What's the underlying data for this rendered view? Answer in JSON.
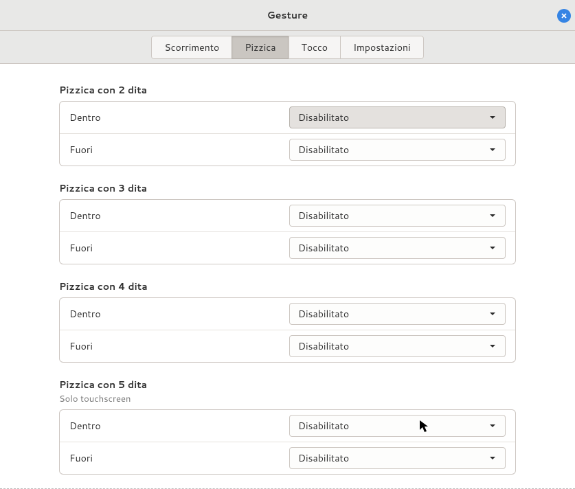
{
  "window": {
    "title": "Gesture"
  },
  "tabs": {
    "scroll": "Scorrimento",
    "pinch": "Pizzica",
    "touch": "Tocco",
    "settings": "Impostazioni",
    "active": "pinch"
  },
  "groups": [
    {
      "title": "Pizzica con 2 dita",
      "subtitle": null,
      "rows": [
        {
          "label": "Dentro",
          "value": "Disabilitato",
          "hover": true
        },
        {
          "label": "Fuori",
          "value": "Disabilitato",
          "hover": false
        }
      ]
    },
    {
      "title": "Pizzica con 3 dita",
      "subtitle": null,
      "rows": [
        {
          "label": "Dentro",
          "value": "Disabilitato",
          "hover": false
        },
        {
          "label": "Fuori",
          "value": "Disabilitato",
          "hover": false
        }
      ]
    },
    {
      "title": "Pizzica con 4 dita",
      "subtitle": null,
      "rows": [
        {
          "label": "Dentro",
          "value": "Disabilitato",
          "hover": false
        },
        {
          "label": "Fuori",
          "value": "Disabilitato",
          "hover": false
        }
      ]
    },
    {
      "title": "Pizzica con 5 dita",
      "subtitle": "Solo touchscreen",
      "rows": [
        {
          "label": "Dentro",
          "value": "Disabilitato",
          "hover": false
        },
        {
          "label": "Fuori",
          "value": "Disabilitato",
          "hover": false
        }
      ]
    }
  ]
}
